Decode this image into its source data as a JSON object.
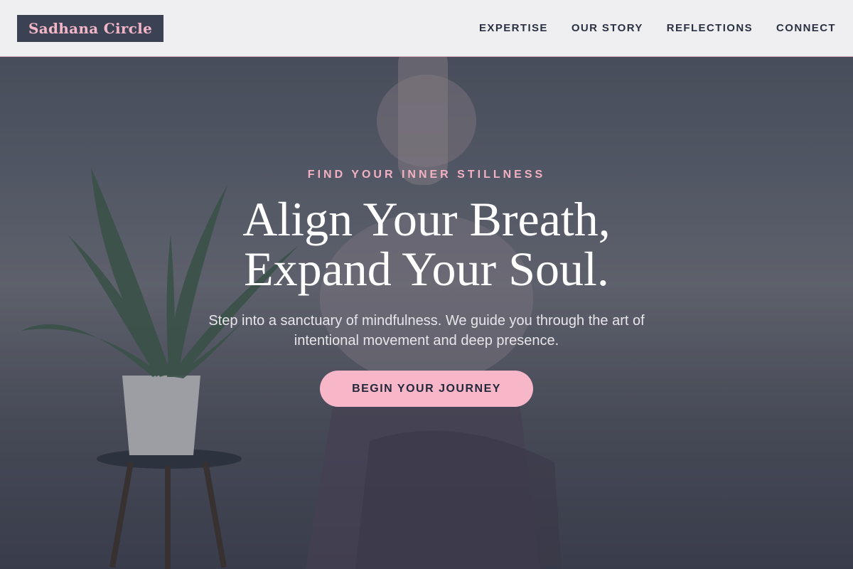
{
  "header": {
    "logo": "Sadhana Circle",
    "nav": [
      {
        "label": "EXPERTISE"
      },
      {
        "label": "OUR STORY"
      },
      {
        "label": "REFLECTIONS"
      },
      {
        "label": "CONNECT"
      }
    ]
  },
  "hero": {
    "eyebrow": "FIND YOUR INNER STILLNESS",
    "headline_line1": "Align Your Breath,",
    "headline_line2": "Expand Your Soul.",
    "subhead": "Step into a sanctuary of mindfulness. We guide you through the art of intentional movement and deep presence.",
    "cta_label": "BEGIN YOUR JOURNEY"
  },
  "colors": {
    "accent_pink": "#f8b7c9",
    "header_bg": "#efeff2",
    "logo_bg": "#3b4253",
    "nav_text": "#2b3142"
  }
}
